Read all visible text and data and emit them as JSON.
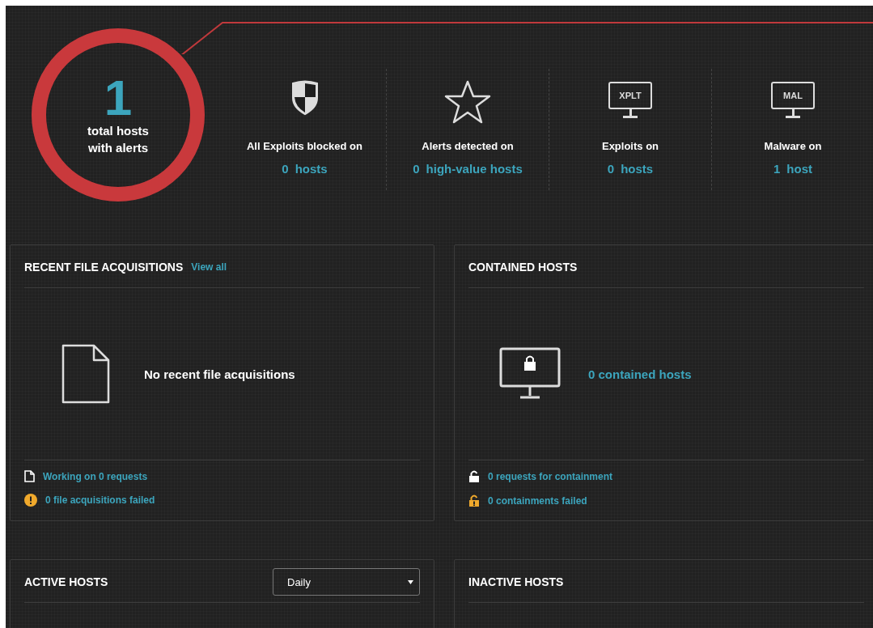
{
  "summary": {
    "count": "1",
    "label": "total hosts with alerts"
  },
  "stats": [
    {
      "kind": "shield",
      "label": "All Exploits blocked on",
      "number": "0",
      "unit": "hosts"
    },
    {
      "kind": "star",
      "label": "Alerts detected on",
      "number": "0",
      "unit": "high-value hosts"
    },
    {
      "kind": "monitor",
      "icon_text": "XPLT",
      "label": "Exploits on",
      "number": "0",
      "unit": "hosts"
    },
    {
      "kind": "monitor",
      "icon_text": "MAL",
      "label": "Malware on",
      "number": "1",
      "unit": "host"
    }
  ],
  "panels": [
    {
      "title": "RECENT FILE ACQUISITIONS",
      "link": "View all",
      "message": {
        "kind": "text",
        "text": "No recent file acquisitions"
      },
      "footer": [
        {
          "kind": "file",
          "text": "Working on 0 requests"
        },
        {
          "kind": "warning",
          "text": "0 file acquisitions failed"
        }
      ]
    },
    {
      "title": "CONTAINED HOSTS",
      "message": {
        "kind": "link",
        "text": "0 contained hosts"
      },
      "footer": [
        {
          "kind": "unlock",
          "text": "0 requests for containment"
        },
        {
          "kind": "unlock-warning",
          "text": "0 containments failed"
        }
      ]
    },
    {
      "title": "ACTIVE HOSTS",
      "select": {
        "value": "Daily"
      }
    },
    {
      "title": "INACTIVE HOSTS"
    }
  ]
}
